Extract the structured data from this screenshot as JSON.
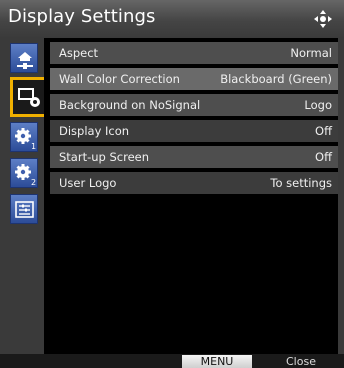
{
  "window": {
    "title": "Display Settings",
    "nav_icon": "four-way-arrows-icon"
  },
  "sidebar": {
    "tabs": [
      {
        "icon": "image-adjust-icon",
        "active": false
      },
      {
        "icon": "display-gear-icon",
        "active": true
      },
      {
        "icon": "gear-1-icon",
        "active": false,
        "badge": "1"
      },
      {
        "icon": "gear-2-icon",
        "active": false,
        "badge": "2"
      },
      {
        "icon": "info-panel-icon",
        "active": false
      }
    ]
  },
  "rows": [
    {
      "label": "Aspect",
      "value": "Normal"
    },
    {
      "label": "Wall Color Correction",
      "value": "Blackboard (Green)"
    },
    {
      "label": "Background on NoSignal",
      "value": "Logo"
    },
    {
      "label": "Display Icon",
      "value": "Off"
    },
    {
      "label": "Start-up Screen",
      "value": "Off"
    },
    {
      "label": "User Logo",
      "value": "To settings"
    }
  ],
  "footer": {
    "menu_label": "MENU",
    "close_label": "Close"
  },
  "colors": {
    "accent": "#f0b000",
    "tab_blue": "#3f5fae"
  }
}
